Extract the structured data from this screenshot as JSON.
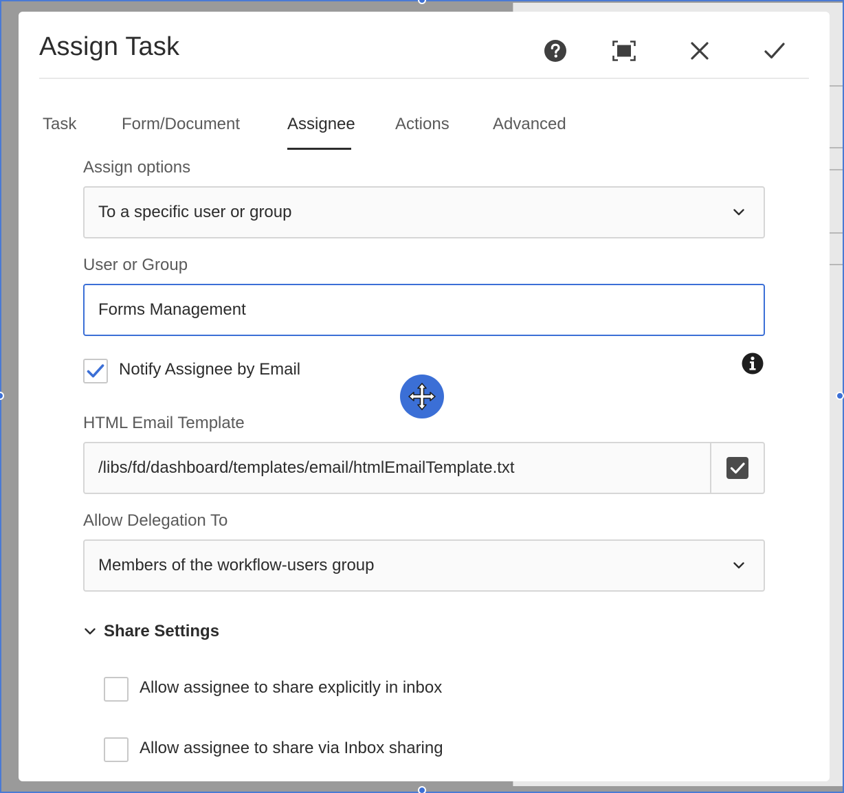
{
  "dialog": {
    "title": "Assign Task",
    "header_icons": [
      "help-icon",
      "fullscreen-icon",
      "close-icon",
      "checkmark-icon"
    ]
  },
  "tabs": [
    {
      "label": "Task",
      "active": false
    },
    {
      "label": "Form/Document",
      "active": false
    },
    {
      "label": "Assignee",
      "active": true
    },
    {
      "label": "Actions",
      "active": false
    },
    {
      "label": "Advanced",
      "active": false
    }
  ],
  "assign_options": {
    "label": "Assign options",
    "value": "To a specific user or group"
  },
  "user_or_group": {
    "label": "User or Group",
    "value": "Forms Management"
  },
  "notify": {
    "label": "Notify Assignee by Email",
    "checked": true
  },
  "email_template": {
    "label": "HTML Email Template",
    "value": "/libs/fd/dashboard/templates/email/htmlEmailTemplate.txt"
  },
  "delegation": {
    "label": "Allow Delegation To",
    "value": "Members of the workflow-users group"
  },
  "share_settings": {
    "title": "Share Settings",
    "expanded": true,
    "options": [
      {
        "label": "Allow assignee to share explicitly in inbox",
        "checked": false
      },
      {
        "label": "Allow assignee to share via Inbox sharing",
        "checked": false
      }
    ]
  },
  "colors": {
    "accent": "#3b6fd6",
    "text": "#2c2c2c",
    "muted_text": "#5a5a5a",
    "border": "#d6d6d6"
  }
}
